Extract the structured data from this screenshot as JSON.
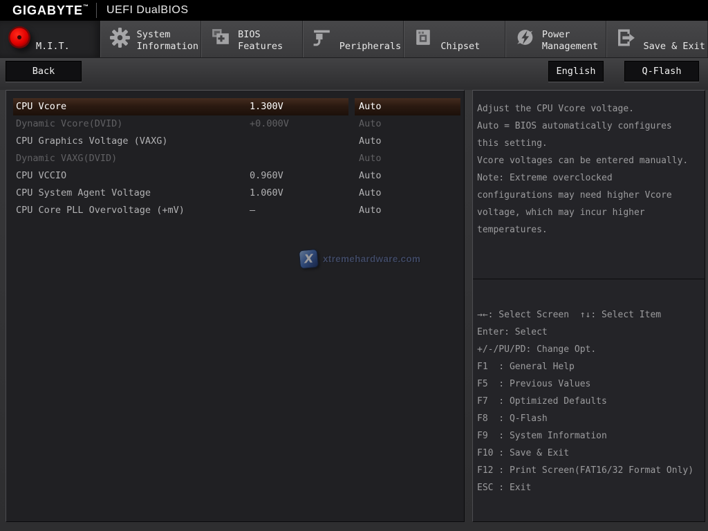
{
  "header": {
    "brand": "GIGABYTE",
    "trademark": "™",
    "title": "UEFI DualBIOS"
  },
  "tabs": [
    {
      "id": "mit",
      "label": "M.I.T.",
      "icon": "mit",
      "active": true
    },
    {
      "id": "system-information",
      "label": "System Information",
      "icon": "system-information",
      "active": false
    },
    {
      "id": "bios-features",
      "label": "BIOS Features",
      "icon": "bios-features",
      "active": false
    },
    {
      "id": "peripherals",
      "label": "Peripherals",
      "icon": "peripherals",
      "active": false
    },
    {
      "id": "chipset",
      "label": "Chipset",
      "icon": "chipset",
      "active": false
    },
    {
      "id": "power-management",
      "label": "Power Management",
      "icon": "power-management",
      "active": false
    },
    {
      "id": "save-exit",
      "label": "Save & Exit",
      "icon": "save-exit",
      "active": false
    }
  ],
  "toolbar": {
    "back": "Back",
    "language": "English",
    "qflash": "Q-Flash"
  },
  "settings": {
    "rows": [
      {
        "name": "CPU Vcore",
        "value": "1.300V",
        "option": "Auto",
        "state": "selected"
      },
      {
        "name": "Dynamic Vcore(DVID)",
        "value": "+0.000V",
        "option": "Auto",
        "state": "dimmed"
      },
      {
        "name": "CPU Graphics Voltage (VAXG)",
        "value": "",
        "option": "Auto",
        "state": "normal"
      },
      {
        "name": "Dynamic VAXG(DVID)",
        "value": "",
        "option": "Auto",
        "state": "dimmed"
      },
      {
        "name": "CPU VCCIO",
        "value": "0.960V",
        "option": "Auto",
        "state": "normal"
      },
      {
        "name": "CPU System Agent Voltage",
        "value": "1.060V",
        "option": "Auto",
        "state": "normal"
      },
      {
        "name": "CPU Core PLL Overvoltage (+mV)",
        "value": "–",
        "option": "Auto",
        "state": "normal"
      }
    ]
  },
  "help": {
    "lines": [
      "Adjust the CPU Vcore voltage.",
      "Auto = BIOS automatically configures",
      "this setting.",
      "Vcore voltages can be entered manually.",
      "Note: Extreme overclocked",
      "configurations may need higher Vcore",
      "voltage, which may incur higher",
      "temperatures."
    ]
  },
  "keys": {
    "lines": [
      "→←: Select Screen  ↑↓: Select Item",
      "Enter: Select",
      "+/-/PU/PD: Change Opt.",
      "F1  : General Help",
      "F5  : Previous Values",
      "F7  : Optimized Defaults",
      "F8  : Q-Flash",
      "F9  : System Information",
      "F10 : Save & Exit",
      "F12 : Print Screen(FAT16/32 Format Only)",
      "ESC : Exit"
    ]
  },
  "watermark": {
    "text": "xtremehardware.com",
    "icon": "x-logo"
  },
  "colors": {
    "accent_red": "#dd0000",
    "selected_row_bg": "#2b1a11",
    "panel_bg": "#202023",
    "top_bar": "#000000",
    "text_normal": "#b2b2b4",
    "text_dimmed": "#606063"
  }
}
